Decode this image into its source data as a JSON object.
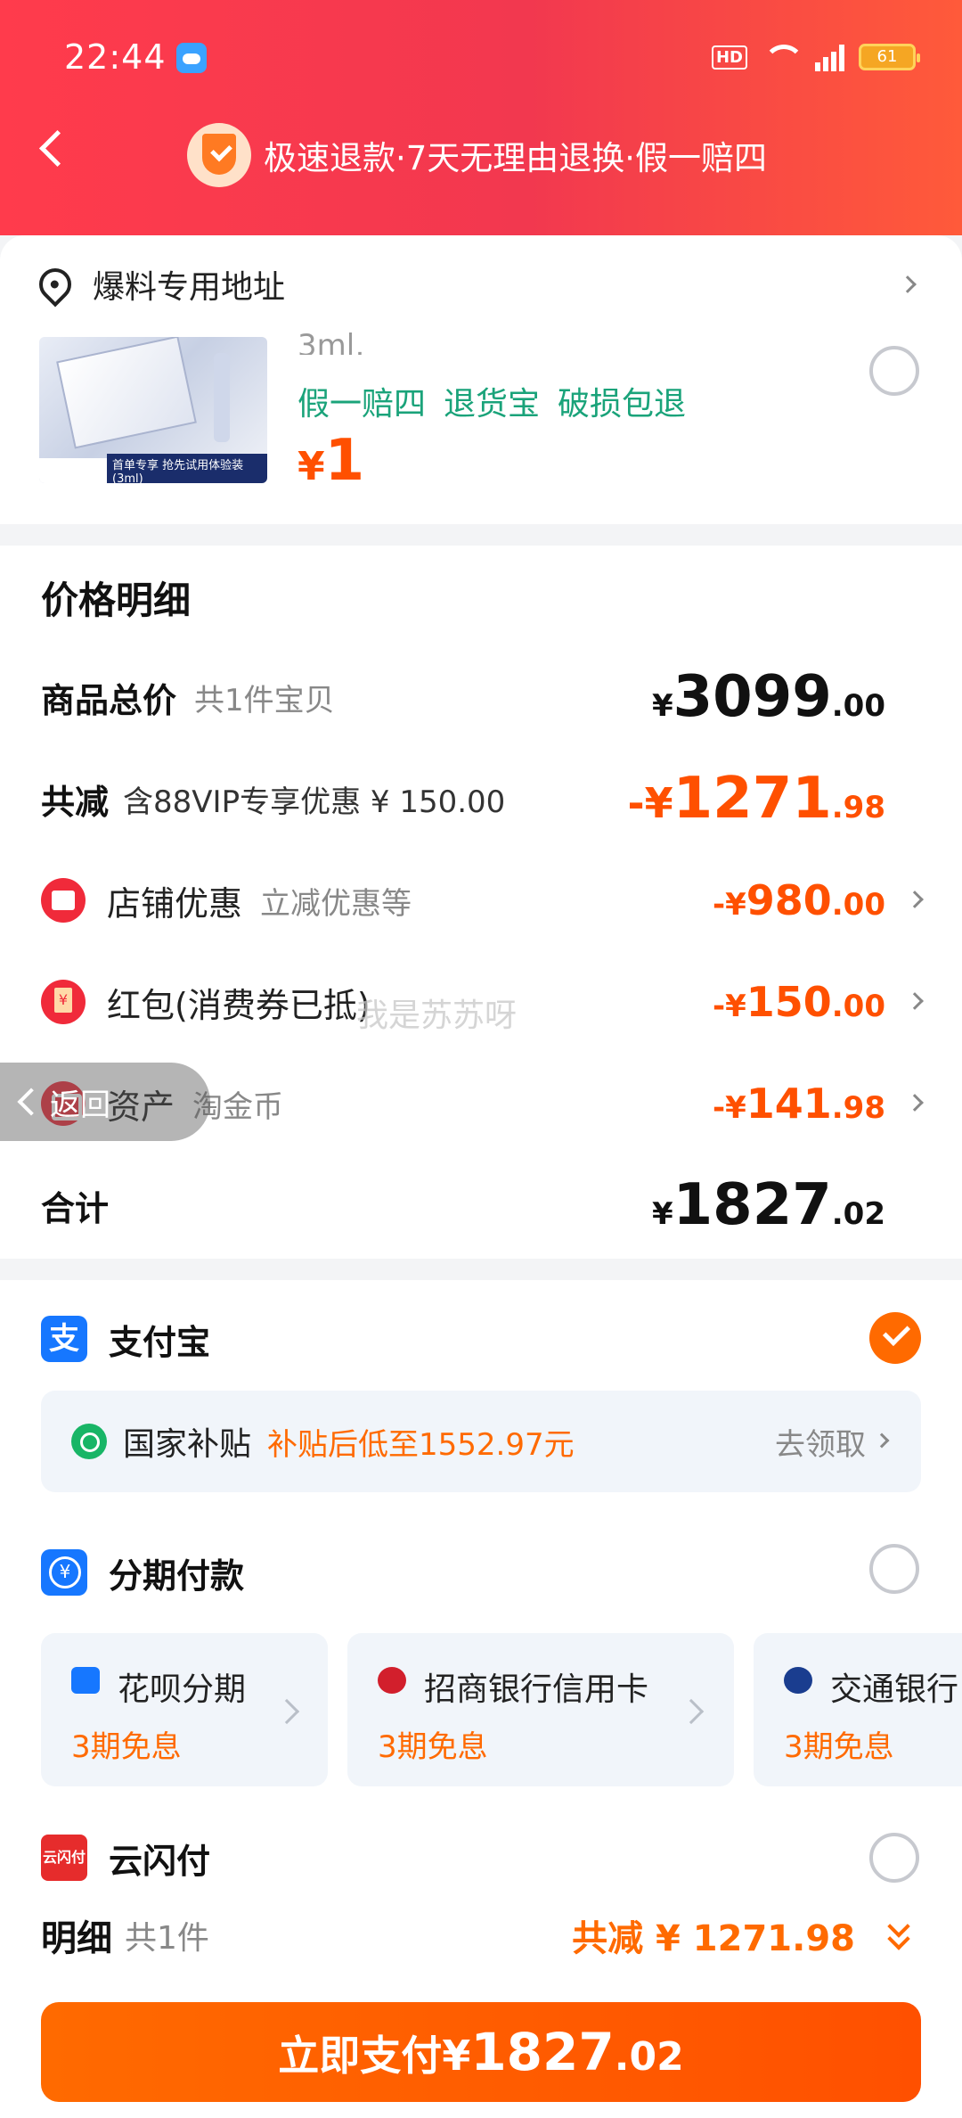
{
  "status_bar": {
    "time": "22:44",
    "hd": "HD",
    "battery": "61"
  },
  "header": {
    "promo_text": "极速退款·7天无理由退换·假一赔四"
  },
  "address": {
    "label": "爆料专用地址"
  },
  "product": {
    "spec_cut": "3ml,",
    "tags": [
      "假一赔四",
      "退货宝",
      "破损包退"
    ],
    "price_currency": "¥",
    "price": "1",
    "thumb_strip_text": "首单专享 抢先试用体验装(3ml)"
  },
  "price_detail": {
    "title": "价格明细",
    "total": {
      "label": "商品总价",
      "sub": "共1件宝贝",
      "currency": "¥",
      "int": "3099",
      "dec": ".00"
    },
    "discount": {
      "label": "共减",
      "sub": "含88VIP专享优惠 ¥ 150.00",
      "prefix": "-¥",
      "int": "1271",
      "dec": ".98"
    },
    "shop": {
      "label": "店铺优惠",
      "sub": "立减优惠等",
      "prefix": "-¥",
      "int": "980",
      "dec": ".00"
    },
    "hongbao": {
      "label": "红包(消费券已抵)",
      "prefix": "-¥",
      "int": "150",
      "dec": ".00"
    },
    "asset": {
      "label": "资产",
      "sub": "淘金币",
      "prefix": "-¥",
      "int": "141",
      "dec": ".98"
    },
    "sum": {
      "label": "合计",
      "currency": "¥",
      "int": "1827",
      "dec": ".02"
    }
  },
  "watermark": "我是苏苏呀",
  "float_back": {
    "label": "返回"
  },
  "payment": {
    "alipay": {
      "name": "支付宝",
      "logo": "支"
    },
    "subsidy": {
      "name": "国家补贴",
      "desc": "补贴后低至1552.97元",
      "link": "去领取"
    },
    "installment": {
      "name": "分期付款"
    },
    "plans": [
      {
        "name": "花呗分期",
        "sub": "3期免息",
        "color": "#1677ff"
      },
      {
        "name": "招商银行信用卡",
        "sub": "3期免息",
        "color": "#d21f2c"
      },
      {
        "name": "交通银行",
        "sub": "3期免息",
        "color": "#1a3d8f"
      }
    ],
    "unionpay": {
      "name": "云闪付",
      "logo": "云闪付"
    }
  },
  "summary": {
    "title": "明细",
    "count": "共1件",
    "reduce": "共减 ¥ 1271.98"
  },
  "pay_button": {
    "label": "立即支付¥",
    "int": "1827",
    "dec": ".02"
  }
}
